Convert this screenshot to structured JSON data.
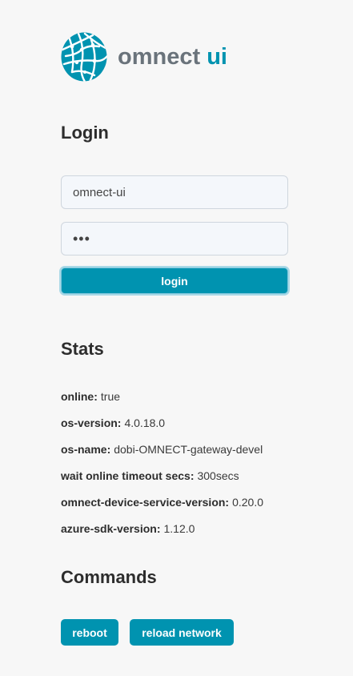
{
  "header": {
    "logo_icon": "omnect-globe-logo-icon",
    "brand_main": "omnect",
    "brand_accent": "ui",
    "accent_color": "#0093b0"
  },
  "login": {
    "heading": "Login",
    "username_value": "omnect-ui",
    "password_value": "•••",
    "submit_label": "login"
  },
  "stats": {
    "heading": "Stats",
    "items": [
      {
        "key": "online:",
        "value": "true"
      },
      {
        "key": "os-version:",
        "value": "4.0.18.0"
      },
      {
        "key": "os-name:",
        "value": "dobi-OMNECT-gateway-devel"
      },
      {
        "key": "wait online timeout secs:",
        "value": "300secs"
      },
      {
        "key": "omnect-device-service-version:",
        "value": "0.20.0"
      },
      {
        "key": "azure-sdk-version:",
        "value": "1.12.0"
      }
    ]
  },
  "commands": {
    "heading": "Commands",
    "reboot_label": "reboot",
    "reload_network_label": "reload network"
  }
}
